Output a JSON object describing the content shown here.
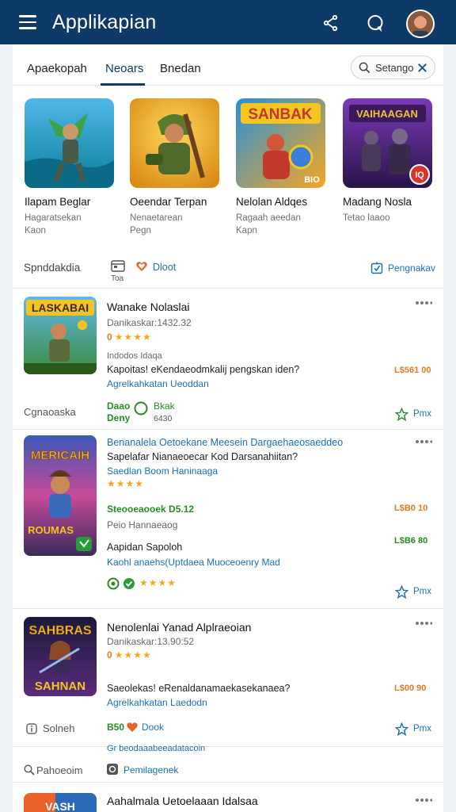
{
  "appbar": {
    "title": "Applikapian"
  },
  "tabs": [
    {
      "label": "Apaekopah"
    },
    {
      "label": "Neoars"
    },
    {
      "label": "Bnedan"
    }
  ],
  "search": {
    "label": "Setango"
  },
  "featured": [
    {
      "title": "Ilapam Beglar",
      "sub1": "Hagaratsekan",
      "sub2": "Kaon"
    },
    {
      "title": "Oeendar Terpan",
      "sub1": "Nenaetarean",
      "sub2": "Pegn"
    },
    {
      "title": "Nelolan Aldqes",
      "sub1": "Ragaah aeedan",
      "sub2": "Kapn"
    },
    {
      "title": "Madang Nosla",
      "sub1": "Tetao laaoo",
      "sub2": ""
    }
  ],
  "featured_art": [
    {
      "banner": ""
    },
    {
      "banner": ""
    },
    {
      "banner": "SANBAK",
      "badge": "BIO"
    },
    {
      "banner": "VAIHAAGAN",
      "badge": "IQ"
    }
  ],
  "filterbar": {
    "label": "Spnddakdia",
    "today": "Toa",
    "about": "Dloot",
    "sort": "Pengnakav"
  },
  "cards": [
    {
      "art_banner": "LASKABAI",
      "title": "Wanake Nolaslai",
      "meta": "Danikaskar:1432.32",
      "rating": "0",
      "stars": "★★★★",
      "tag": "Indodos Idaqa",
      "desc": "Kapoitas! eKendaeodmkalij pengskan iden?",
      "link": "Agrelkahkatan Ueoddan",
      "price": "L$561 00",
      "foot_label": "Cgnaoaska",
      "foot_green1": "Daao",
      "foot_green2": "Deny",
      "foot_green3": "Bkak",
      "foot_small": "6430",
      "star_btn": "Pmx"
    },
    {
      "art_banner": "MERICAIH",
      "art_banner2": "ROUMAS",
      "title": "Benanalela Oetoekane Meesein Dargaehaeosaeddeo",
      "line1": "Sapelafar Nianaeoecar Kod Darsanahiitan?",
      "line2": "Saedlan Boom Haninaaga",
      "stars": "★★★★",
      "green_line": "Steooeaooek D5.12",
      "price1": "L$B0 10",
      "line3": "Peio Hannaeaog",
      "price2": "L$B6 80",
      "line4": "Aapidan Sapoloh",
      "link": "Kaohl anaehs(Uptdaea Muoceoenry Mad",
      "stars2": "★★★★",
      "star_btn": "Pmx"
    },
    {
      "art_banner": "SAHBRAS",
      "art_banner2": "SAHNAN",
      "title": "Nenolenlai Yanad Alplraeoian",
      "meta": "Danikaskar:13.90:52",
      "rating": "0",
      "stars": "★★★★",
      "desc": "Saeolekas! eRenaldanamaekasekanaea?",
      "link": "Agrelkahkatan Laedodn",
      "price": "L$00 90",
      "foot_label": "Solneh",
      "foot_green": "B50",
      "foot_blue": "Dook",
      "star_btn": "Pmx"
    }
  ],
  "bottom": {
    "clipped": "Gr beodaaabeeadatacoin",
    "label": "Pahoeoim",
    "badge": "Pemilagenek",
    "title": "Aahalmala Uetoelaaan Idalsaa",
    "card_art": "VASH"
  }
}
